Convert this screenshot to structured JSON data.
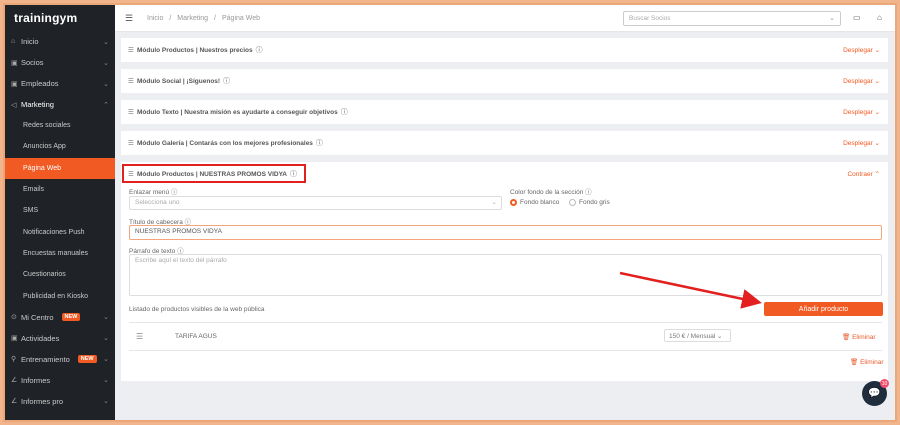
{
  "app": {
    "logo": "trainingym"
  },
  "sidebar": {
    "items": [
      {
        "icon": "⌂",
        "label": "Inicio",
        "chev": "⌄"
      },
      {
        "icon": "▣",
        "label": "Socios",
        "chev": "⌄"
      },
      {
        "icon": "▣",
        "label": "Empleados",
        "chev": "⌄"
      },
      {
        "icon": "◁",
        "label": "Marketing",
        "chev": "⌃"
      }
    ],
    "sub_items": [
      "Redes sociales",
      "Anuncios App",
      "Página Web",
      "Emails",
      "SMS",
      "Notificaciones Push",
      "Encuestas manuales",
      "Cuestionarios",
      "Publicidad en Kiosko"
    ],
    "bottom_items": [
      {
        "icon": "⊙",
        "label": "Mi Centro",
        "badge": "NEW",
        "chev": "⌄"
      },
      {
        "icon": "▣",
        "label": "Actividades",
        "badge": "",
        "chev": "⌄"
      },
      {
        "icon": "⚲",
        "label": "Entrenamiento",
        "badge": "NEW",
        "chev": "⌄"
      },
      {
        "icon": "∠",
        "label": "Informes",
        "badge": "",
        "chev": "⌄"
      },
      {
        "icon": "∠",
        "label": "Informes pro",
        "badge": "",
        "chev": "⌄"
      }
    ]
  },
  "topbar": {
    "menu_icon": "☰",
    "breadcrumb": [
      "Inicio",
      "/",
      "Marketing",
      "/",
      "Página Web"
    ],
    "search_placeholder": "Buscar Socios",
    "search_dropdown": "⌄",
    "icons": [
      "▭",
      "⌂"
    ]
  },
  "modules": [
    {
      "title": "Módulo Productos | Nuestros precios",
      "toggle": "Desplegar ⌄"
    },
    {
      "title": "Módulo Social | ¡Síguenos!",
      "toggle": "Desplegar ⌄"
    },
    {
      "title": "Módulo Texto | Nuestra misión es ayudarte a conseguir objetivos",
      "toggle": "Desplegar ⌄"
    },
    {
      "title": "Módulo Galería | Contarás con los mejores profesionales",
      "toggle": "Desplegar ⌄"
    }
  ],
  "expanded": {
    "title": "Módulo Productos | NUESTRAS PROMOS VIDYA",
    "toggle": "Contraer ⌃",
    "menu_label": "Enlazar menú",
    "menu_placeholder": "Selecciona uno",
    "bg_label": "Color fondo de la sección",
    "radio_white": "Fondo blanco",
    "radio_grey": "Fondo gris",
    "header_label": "Título de cabecera",
    "header_value": "NUESTRAS PROMOS VIDYA",
    "text_label": "Párrafo de texto",
    "text_placeholder": "Escribe aquí el texto del párrafo",
    "list_label": "Listado de productos visibles de la web pública",
    "add_button": "Añadir producto",
    "product_name": "TARIFA AGUS",
    "product_price": "150 € / Mensual ⌄",
    "delete_label": "Eliminar",
    "delete_label2": "Eliminar"
  },
  "info_glyph": "ⓘ",
  "drag_glyph": "☰",
  "trash_glyph": "🗑",
  "chat": {
    "badge": "10"
  },
  "colors": {
    "accent": "#f15a22",
    "sidebar": "#1f2328",
    "highlight": "#e32020"
  }
}
